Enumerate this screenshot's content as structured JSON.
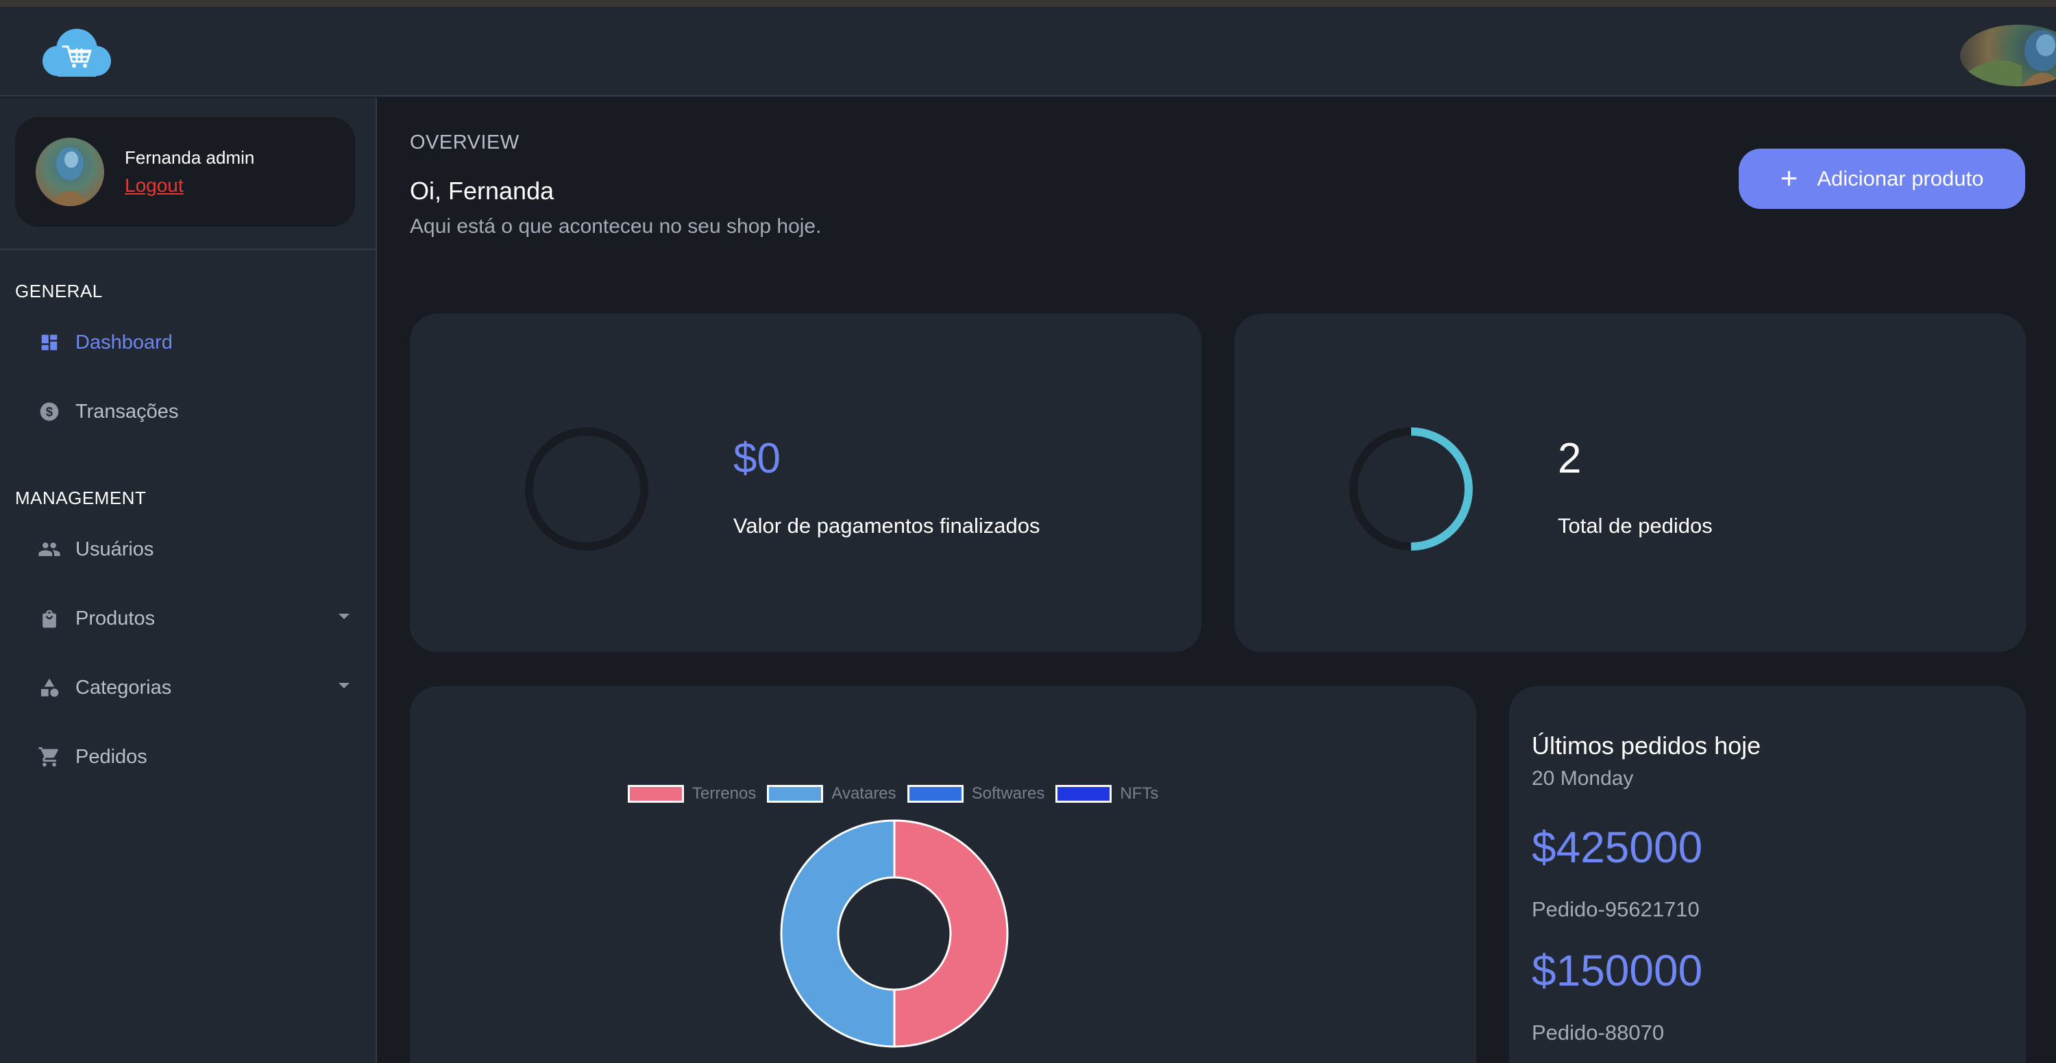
{
  "sidebar": {
    "profile": {
      "name": "Fernanda admin",
      "logout_label": "Logout"
    },
    "sections": [
      {
        "label": "GENERAL",
        "items": [
          {
            "label": "Dashboard",
            "icon": "dashboard-icon",
            "active": true
          },
          {
            "label": "Transações",
            "icon": "dollar-circle-icon"
          }
        ]
      },
      {
        "label": "MANAGEMENT",
        "items": [
          {
            "label": "Usuários",
            "icon": "users-icon"
          },
          {
            "label": "Produtos",
            "icon": "shopping-bag-icon",
            "has_dropdown": true
          },
          {
            "label": "Categorias",
            "icon": "shapes-icon",
            "has_dropdown": true
          },
          {
            "label": "Pedidos",
            "icon": "cart-icon"
          }
        ]
      }
    ]
  },
  "main": {
    "overview_label": "OVERVIEW",
    "greeting": "Oi, Fernanda",
    "subtitle": "Aqui está o que aconteceu no seu shop hoje.",
    "add_button_label": "Adicionar produto",
    "stats": [
      {
        "value": "$0",
        "label": "Valor de pagamentos finalizados",
        "progress": 0
      },
      {
        "value": "2",
        "label": "Total de pedidos",
        "progress": 0.5
      }
    ],
    "latest_orders": {
      "title": "Últimos pedidos hoje",
      "date": "20 Monday",
      "orders": [
        {
          "amount": "$425000",
          "id": "Pedido-95621710"
        },
        {
          "amount": "$150000",
          "id": "Pedido-88070"
        }
      ]
    }
  },
  "colors": {
    "accent": "#7083f2",
    "progress_ring": "#56c1d6",
    "logout": "#e53935",
    "terrenos": "#ee6e84",
    "avatares": "#5aa2e0",
    "softwares": "#2f6fe0",
    "nfts": "#1f36e0"
  },
  "chart_data": {
    "type": "pie",
    "categories": [
      "Terrenos",
      "Avatares",
      "Softwares",
      "NFTs"
    ],
    "values": [
      1,
      1,
      0,
      0
    ],
    "colors": [
      "#ee6e84",
      "#5aa2e0",
      "#2f6fe0",
      "#1f36e0"
    ],
    "legend": "top"
  }
}
